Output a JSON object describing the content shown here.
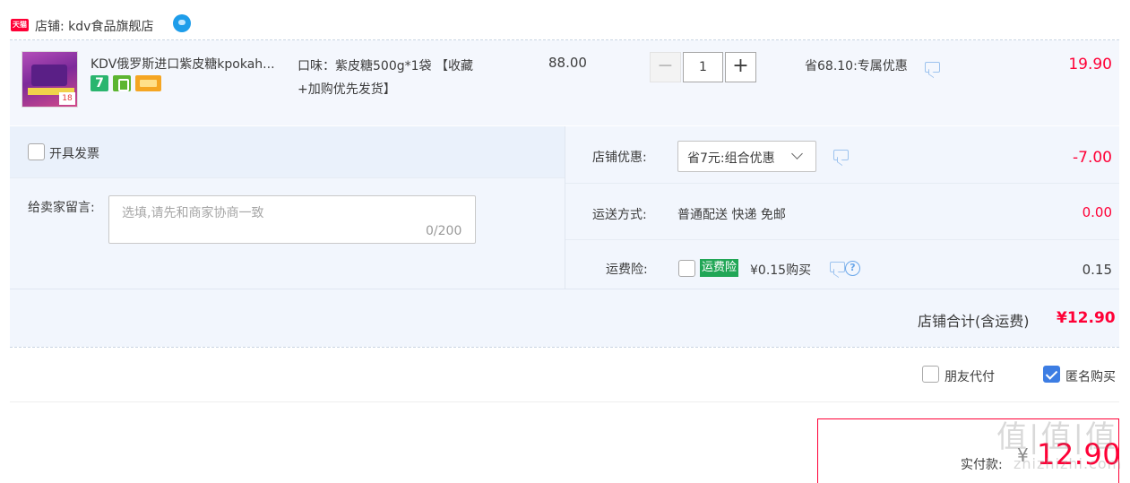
{
  "shop": {
    "badge": "天猫",
    "label": "店铺: kdv食品旗舰店"
  },
  "item": {
    "thumb_tag": "18",
    "title": "KDV俄罗斯进口紫皮糖kpokah...",
    "service_seven": "7",
    "sku_line1": "口味：紫皮糖500g*1袋 【收藏",
    "sku_line2": "+加购优先发货】",
    "price": "88.00",
    "qty_minus": "−",
    "qty": "1",
    "qty_plus": "+",
    "promo": "省68.10:专属优惠",
    "total": "19.90"
  },
  "options": {
    "invoice_label": "开具发票",
    "memo_label": "给卖家留言:",
    "memo_placeholder": "选填,请先和商家协商一致",
    "memo_count": "0/200",
    "shop_discount_label": "店铺优惠:",
    "shop_discount_selected": "省7元:组合优惠",
    "shop_discount_value": "-7.00",
    "shipping_label": "运送方式:",
    "shipping_value": "普通配送 快递 免邮",
    "shipping_fee": "0.00",
    "insurance_label": "运费险:",
    "insurance_tag": "运费险",
    "insurance_desc": "¥0.15购买",
    "insurance_fee": "0.15",
    "help_glyph": "?",
    "shop_total_label": "店铺合计(含运费)",
    "shop_total_value": "¥12.90"
  },
  "footer": {
    "friend_pay_label": "朋友代付",
    "anonymous_label": "匿名购买",
    "anonymous_checked": true,
    "pay_label": "实付款:",
    "pay_currency": "¥",
    "pay_value": "12.90",
    "watermark": "值|值|值",
    "watermark_sub": "zhizhizhi.com"
  },
  "colors": {
    "accent_red": "#ff0036",
    "tmall_red": "#ff0036",
    "panel_blue": "#f2f6fd",
    "insurance_green": "#21a656",
    "checkbox_blue": "#3d7de3"
  }
}
